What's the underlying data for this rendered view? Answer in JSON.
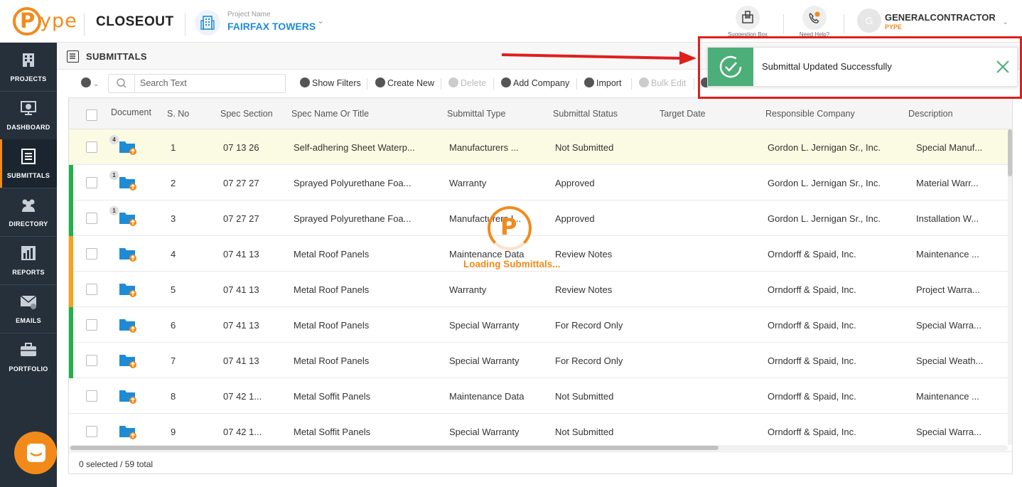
{
  "header": {
    "brand": "Pype",
    "module": "CLOSEOUT",
    "project_label": "Project Name",
    "project_name": "FAIRFAX TOWERS",
    "suggestion_label": "Suggestion Box",
    "help_label": "Need Help?",
    "user_initial": "G",
    "user_name": "GENERALCONTRACTOR",
    "user_org": "PYPE"
  },
  "sidebar": {
    "items": [
      {
        "label": "PROJECTS",
        "icon": "building-icon"
      },
      {
        "label": "DASHBOARD",
        "icon": "dashboard-icon"
      },
      {
        "label": "SUBMITTALS",
        "icon": "submittals-icon"
      },
      {
        "label": "DIRECTORY",
        "icon": "users-icon"
      },
      {
        "label": "REPORTS",
        "icon": "reports-icon"
      },
      {
        "label": "EMAILS",
        "icon": "email-icon"
      },
      {
        "label": "PORTFOLIO",
        "icon": "briefcase-icon"
      }
    ],
    "active_index": 2
  },
  "page": {
    "title": "SUBMITTALS"
  },
  "toolbar": {
    "search_placeholder": "Search Text",
    "show_filters": "Show Filters",
    "create_new": "Create New",
    "delete": "Delete",
    "add_company": "Add Company",
    "import": "Import",
    "bulk_edit": "Bulk Edit"
  },
  "table": {
    "columns": [
      "Document",
      "S. No",
      "Spec Section",
      "Spec Name Or Title",
      "Submittal Type",
      "Submittal Status",
      "Target Date",
      "Responsible Company",
      "Description"
    ],
    "rows": [
      {
        "badge": "4",
        "sno": "1",
        "spec": "07 13 26",
        "name": "Self-adhering Sheet Waterp...",
        "type": "Manufacturers ...",
        "status": "Not Submitted",
        "target": "",
        "company": "Gordon L. Jernigan Sr., Inc.",
        "desc": "Special Manuf...",
        "bar": "",
        "highlight": true
      },
      {
        "badge": "1",
        "sno": "2",
        "spec": "07 27 27",
        "name": "Sprayed Polyurethane Foa...",
        "type": "Warranty",
        "status": "Approved",
        "target": "",
        "company": "Gordon L. Jernigan Sr., Inc.",
        "desc": "Material Warr...",
        "bar": "#1fb24a",
        "highlight": false
      },
      {
        "badge": "1",
        "sno": "3",
        "spec": "07 27 27",
        "name": "Sprayed Polyurethane Foa...",
        "type": "Manufacturers I...",
        "status": "Approved",
        "target": "",
        "company": "Gordon L. Jernigan Sr., Inc.",
        "desc": "Installation W...",
        "bar": "#1fb24a",
        "highlight": false
      },
      {
        "badge": "",
        "sno": "4",
        "spec": "07 41 13",
        "name": "Metal Roof Panels",
        "type": "Maintenance Data",
        "status": "Review Notes",
        "target": "",
        "company": "Orndorff & Spaid, Inc.",
        "desc": "Maintenance ...",
        "bar": "#f7a21b",
        "highlight": false
      },
      {
        "badge": "",
        "sno": "5",
        "spec": "07 41 13",
        "name": "Metal Roof Panels",
        "type": "Warranty",
        "status": "Review Notes",
        "target": "",
        "company": "Orndorff & Spaid, Inc.",
        "desc": "Project Warra...",
        "bar": "#f7a21b",
        "highlight": false
      },
      {
        "badge": "",
        "sno": "6",
        "spec": "07 41 13",
        "name": "Metal Roof Panels",
        "type": "Special Warranty",
        "status": "For Record Only",
        "target": "",
        "company": "Orndorff & Spaid, Inc.",
        "desc": "Special Warra...",
        "bar": "#1fb24a",
        "highlight": false
      },
      {
        "badge": "",
        "sno": "7",
        "spec": "07 41 13",
        "name": "Metal Roof Panels",
        "type": "Special Warranty",
        "status": "For Record Only",
        "target": "",
        "company": "Orndorff & Spaid, Inc.",
        "desc": "Special Weath...",
        "bar": "#1fb24a",
        "highlight": false
      },
      {
        "badge": "",
        "sno": "8",
        "spec": "07 42 1...",
        "name": "Metal Soffit Panels",
        "type": "Maintenance Data",
        "status": "Not Submitted",
        "target": "",
        "company": "Orndorff & Spaid, Inc.",
        "desc": "Maintenance ...",
        "bar": "",
        "highlight": false
      },
      {
        "badge": "",
        "sno": "9",
        "spec": "07 42 1...",
        "name": "Metal Soffit Panels",
        "type": "Special Warranty",
        "status": "Not Submitted",
        "target": "",
        "company": "Orndorff & Spaid, Inc.",
        "desc": "Special Warra...",
        "bar": "",
        "highlight": false
      }
    ],
    "footer": "0 selected / 59 total"
  },
  "loader": {
    "text": "Loading Submittals..."
  },
  "toast": {
    "message": "Submittal Updated Successfully"
  },
  "colors": {
    "brand_orange": "#f28a1a",
    "sidebar_bg": "#25303b",
    "project_blue": "#1e8bd6",
    "success_green": "#4cae78",
    "annotation_red": "#e01e1e"
  }
}
